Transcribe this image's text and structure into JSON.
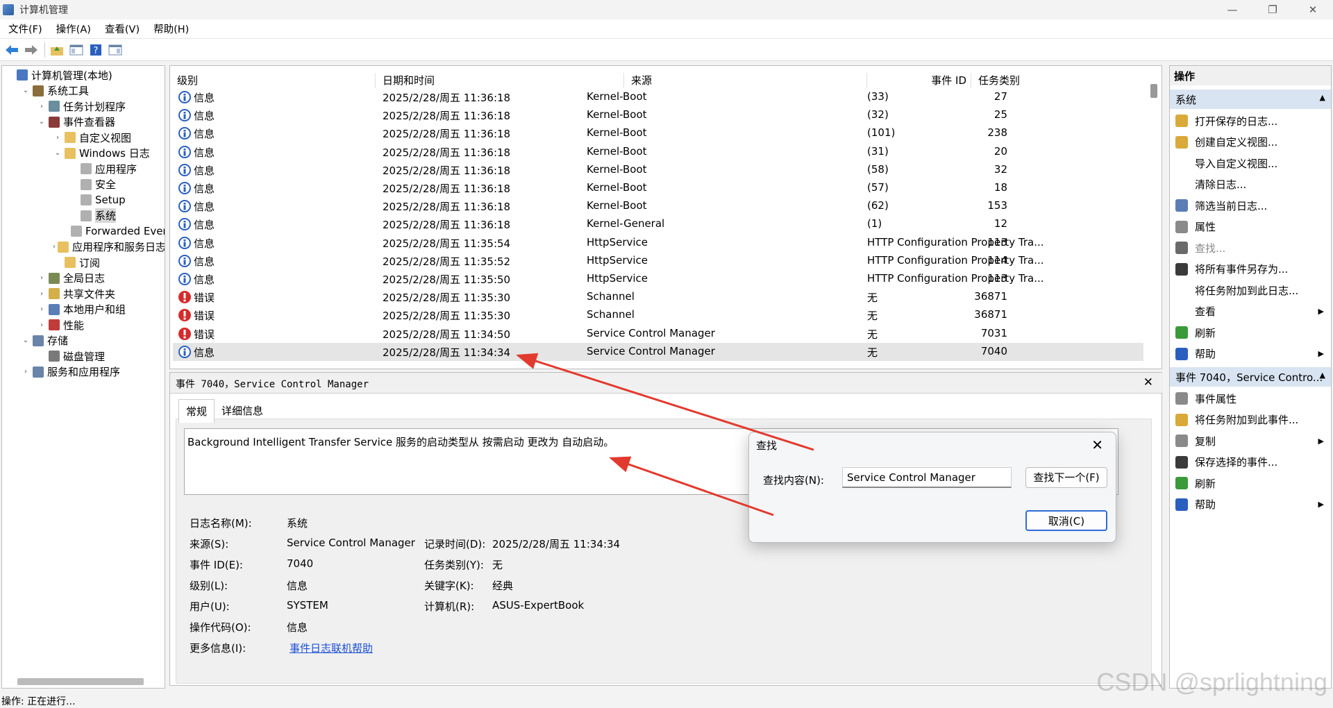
{
  "window": {
    "title": "计算机管理"
  },
  "menu": [
    "文件(F)",
    "操作(A)",
    "查看(V)",
    "帮助(H)"
  ],
  "tree": [
    {
      "label": "计算机管理(本地)",
      "indent": 0,
      "chev": "",
      "icon": "computer-icon",
      "color": "#4a78c0"
    },
    {
      "label": "系统工具",
      "indent": 1,
      "chev": "⌄",
      "icon": "tools-icon",
      "color": "#8a6d3b"
    },
    {
      "label": "任务计划程序",
      "indent": 2,
      "chev": "›",
      "icon": "clock-icon",
      "color": "#6b8e9f"
    },
    {
      "label": "事件查看器",
      "indent": 2,
      "chev": "⌄",
      "icon": "event-viewer-icon",
      "color": "#8b3a3a"
    },
    {
      "label": "自定义视图",
      "indent": 3,
      "chev": "›",
      "icon": "folder-icon",
      "color": "#e8c060"
    },
    {
      "label": "Windows 日志",
      "indent": 3,
      "chev": "⌄",
      "icon": "folder-icon",
      "color": "#e8c060"
    },
    {
      "label": "应用程序",
      "indent": 4,
      "chev": "",
      "icon": "log-icon",
      "color": "#b0b0b0"
    },
    {
      "label": "安全",
      "indent": 4,
      "chev": "",
      "icon": "log-icon",
      "color": "#b0b0b0"
    },
    {
      "label": "Setup",
      "indent": 4,
      "chev": "",
      "icon": "log-icon",
      "color": "#b0b0b0"
    },
    {
      "label": "系统",
      "indent": 4,
      "chev": "",
      "icon": "log-icon",
      "color": "#b0b0b0",
      "selected": true
    },
    {
      "label": "Forwarded Even",
      "indent": 4,
      "chev": "",
      "icon": "log-icon",
      "color": "#b0b0b0"
    },
    {
      "label": "应用程序和服务日志",
      "indent": 3,
      "chev": "›",
      "icon": "folder-icon",
      "color": "#e8c060"
    },
    {
      "label": "订阅",
      "indent": 3,
      "chev": "",
      "icon": "subscription-icon",
      "color": "#e8c060"
    },
    {
      "label": "全局日志",
      "indent": 2,
      "chev": "›",
      "icon": "log-icon",
      "color": "#7a8a55"
    },
    {
      "label": "共享文件夹",
      "indent": 2,
      "chev": "›",
      "icon": "shared-folder-icon",
      "color": "#d4b04a"
    },
    {
      "label": "本地用户和组",
      "indent": 2,
      "chev": "›",
      "icon": "users-icon",
      "color": "#5a7db5"
    },
    {
      "label": "性能",
      "indent": 2,
      "chev": "›",
      "icon": "performance-icon",
      "color": "#c23b3b"
    },
    {
      "label": "存储",
      "indent": 1,
      "chev": "⌄",
      "icon": "storage-icon",
      "color": "#6a84a8"
    },
    {
      "label": "磁盘管理",
      "indent": 2,
      "chev": "",
      "icon": "disk-icon",
      "color": "#7a7a7a"
    },
    {
      "label": "服务和应用程序",
      "indent": 1,
      "chev": "›",
      "icon": "services-icon",
      "color": "#6a84a8"
    }
  ],
  "list": {
    "columns": [
      "级别",
      "日期和时间",
      "来源",
      "事件 ID",
      "任务类别"
    ],
    "rows": [
      {
        "level": "信息",
        "type": "info",
        "date": "2025/2/28/周五 11:36:18",
        "source": "Kernel-Boot",
        "id": "27",
        "task": "(33)"
      },
      {
        "level": "信息",
        "type": "info",
        "date": "2025/2/28/周五 11:36:18",
        "source": "Kernel-Boot",
        "id": "25",
        "task": "(32)"
      },
      {
        "level": "信息",
        "type": "info",
        "date": "2025/2/28/周五 11:36:18",
        "source": "Kernel-Boot",
        "id": "238",
        "task": "(101)"
      },
      {
        "level": "信息",
        "type": "info",
        "date": "2025/2/28/周五 11:36:18",
        "source": "Kernel-Boot",
        "id": "20",
        "task": "(31)"
      },
      {
        "level": "信息",
        "type": "info",
        "date": "2025/2/28/周五 11:36:18",
        "source": "Kernel-Boot",
        "id": "32",
        "task": "(58)"
      },
      {
        "level": "信息",
        "type": "info",
        "date": "2025/2/28/周五 11:36:18",
        "source": "Kernel-Boot",
        "id": "18",
        "task": "(57)"
      },
      {
        "level": "信息",
        "type": "info",
        "date": "2025/2/28/周五 11:36:18",
        "source": "Kernel-Boot",
        "id": "153",
        "task": "(62)"
      },
      {
        "level": "信息",
        "type": "info",
        "date": "2025/2/28/周五 11:36:18",
        "source": "Kernel-General",
        "id": "12",
        "task": "(1)"
      },
      {
        "level": "信息",
        "type": "info",
        "date": "2025/2/28/周五 11:35:54",
        "source": "HttpService",
        "id": "113",
        "task": "HTTP Configuration Property Tra..."
      },
      {
        "level": "信息",
        "type": "info",
        "date": "2025/2/28/周五 11:35:52",
        "source": "HttpService",
        "id": "114",
        "task": "HTTP Configuration Property Tra..."
      },
      {
        "level": "信息",
        "type": "info",
        "date": "2025/2/28/周五 11:35:50",
        "source": "HttpService",
        "id": "113",
        "task": "HTTP Configuration Property Tra..."
      },
      {
        "level": "错误",
        "type": "error",
        "date": "2025/2/28/周五 11:35:30",
        "source": "Schannel",
        "id": "36871",
        "task": "无"
      },
      {
        "level": "错误",
        "type": "error",
        "date": "2025/2/28/周五 11:35:30",
        "source": "Schannel",
        "id": "36871",
        "task": "无"
      },
      {
        "level": "错误",
        "type": "error",
        "date": "2025/2/28/周五 11:34:50",
        "source": "Service Control Manager",
        "id": "7031",
        "task": "无"
      },
      {
        "level": "信息",
        "type": "info",
        "date": "2025/2/28/周五 11:34:34",
        "source": "Service Control Manager",
        "id": "7040",
        "task": "无",
        "selected": true
      }
    ]
  },
  "detail": {
    "header": "事件 7040，Service Control Manager",
    "tabs": [
      "常规",
      "详细信息"
    ],
    "description": "Background Intelligent Transfer Service 服务的启动类型从 按需启动 更改为 自动启动。",
    "fields": {
      "log_label": "日志名称(M):",
      "log": "系统",
      "source_label": "来源(S):",
      "source": "Service Control Manager",
      "recorded_label": "记录时间(D):",
      "recorded": "2025/2/28/周五 11:34:34",
      "eventid_label": "事件 ID(E):",
      "eventid": "7040",
      "task_label": "任务类别(Y):",
      "task": "无",
      "level_label": "级别(L):",
      "level": "信息",
      "keywords_label": "关键字(K):",
      "keywords": "经典",
      "user_label": "用户(U):",
      "user": "SYSTEM",
      "computer_label": "计算机(R):",
      "computer": "ASUS-ExpertBook",
      "opcode_label": "操作代码(O):",
      "opcode": "信息",
      "moreinfo_label": "更多信息(I):",
      "moreinfo": "事件日志联机帮助"
    }
  },
  "actions": {
    "title": "操作",
    "section1": "系统",
    "items1": [
      {
        "label": "打开保存的日志...",
        "icon": "open-log-icon",
        "color": "#d9a93a"
      },
      {
        "label": "创建自定义视图...",
        "icon": "filter-icon",
        "color": "#d9a93a"
      },
      {
        "label": "导入自定义视图...",
        "icon": "",
        "color": ""
      },
      {
        "label": "清除日志...",
        "icon": "",
        "color": ""
      },
      {
        "label": "筛选当前日志...",
        "icon": "filter-icon",
        "color": "#5a7db5"
      },
      {
        "label": "属性",
        "icon": "properties-icon",
        "color": "#8a8a8a"
      },
      {
        "label": "查找...",
        "icon": "binoculars-icon",
        "color": "#6a6a6a",
        "dim": true
      },
      {
        "label": "将所有事件另存为...",
        "icon": "save-icon",
        "color": "#3a3a3a"
      },
      {
        "label": "将任务附加到此日志...",
        "icon": "",
        "color": ""
      },
      {
        "label": "查看",
        "icon": "",
        "color": "",
        "sub": "▶"
      },
      {
        "label": "刷新",
        "icon": "refresh-icon",
        "color": "#3a9a3a"
      },
      {
        "label": "帮助",
        "icon": "help-icon",
        "color": "#2a5fc0",
        "sub": "▶"
      }
    ],
    "section2": "事件 7040，Service Contro...",
    "items2": [
      {
        "label": "事件属性",
        "icon": "properties-icon",
        "color": "#8a8a8a"
      },
      {
        "label": "将任务附加到此事件...",
        "icon": "task-icon",
        "color": "#d9a93a"
      },
      {
        "label": "复制",
        "icon": "copy-icon",
        "color": "#8a8a8a",
        "sub": "▶"
      },
      {
        "label": "保存选择的事件...",
        "icon": "save-icon",
        "color": "#3a3a3a"
      },
      {
        "label": "刷新",
        "icon": "refresh-icon",
        "color": "#3a9a3a"
      },
      {
        "label": "帮助",
        "icon": "help-icon",
        "color": "#2a5fc0",
        "sub": "▶"
      }
    ]
  },
  "find_dialog": {
    "title": "查找",
    "label": "查找内容(N):",
    "value": "Service Control Manager",
    "find_next": "查找下一个(F)",
    "cancel": "取消(C)"
  },
  "status": "操作: 正在进行...",
  "watermark": "CSDN @sprlightning"
}
